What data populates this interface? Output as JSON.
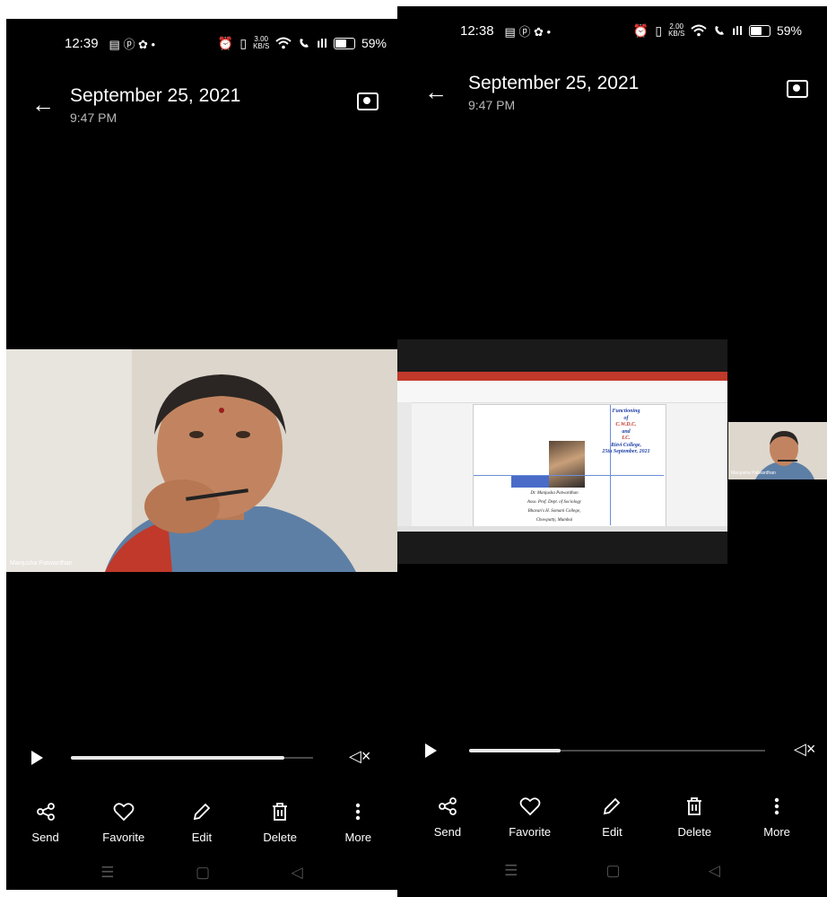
{
  "left": {
    "status": {
      "time": "12:39",
      "icons_left": "▤ ⓟ ✿ •",
      "alarm": "⏰",
      "vibrate": "▯",
      "speed": "3.00",
      "speed_unit": "KB/S",
      "wifi": "wifi",
      "signal": "ıll",
      "battery": "59%"
    },
    "header": {
      "date": "September 25, 2021",
      "time": "9:47 PM"
    },
    "participant_name": "Manjusha Patwardhan",
    "progress": 0.88,
    "actions": [
      {
        "label": "Send",
        "icon": "share-icon"
      },
      {
        "label": "Favorite",
        "icon": "heart-icon"
      },
      {
        "label": "Edit",
        "icon": "pencil-icon"
      },
      {
        "label": "Delete",
        "icon": "trash-icon"
      },
      {
        "label": "More",
        "icon": "more-icon"
      }
    ]
  },
  "right": {
    "status": {
      "time": "12:38",
      "icons_left": "▤ ⓟ ✿ •",
      "alarm": "⏰",
      "vibrate": "▯",
      "speed": "2.00",
      "speed_unit": "KB/S",
      "wifi": "wifi",
      "signal": "ıll",
      "battery": "59%"
    },
    "header": {
      "date": "September 25, 2021",
      "time": "9:47 PM"
    },
    "participant_name": "Manjusha Patwardhan",
    "slide": {
      "title_lines": [
        "Functioning",
        "of",
        "C.W.D.C.",
        "and",
        "I.C.",
        "Rizvi College,",
        "25th September, 2021"
      ],
      "presenter_lines": [
        "Dr. Manjusha Patwardhan",
        "Asso. Prof. Dept. of Sociology",
        "Bhavan's H. Somani College,",
        "Chowpatty, Mumbai"
      ]
    },
    "progress": 0.31,
    "actions": [
      {
        "label": "Send",
        "icon": "share-icon"
      },
      {
        "label": "Favorite",
        "icon": "heart-icon"
      },
      {
        "label": "Edit",
        "icon": "pencil-icon"
      },
      {
        "label": "Delete",
        "icon": "trash-icon"
      },
      {
        "label": "More",
        "icon": "more-icon"
      }
    ]
  },
  "colors": {
    "slide_title": "#1f3fa6",
    "slide_accent": "#c0392b",
    "ribbon": "#c0392b"
  }
}
